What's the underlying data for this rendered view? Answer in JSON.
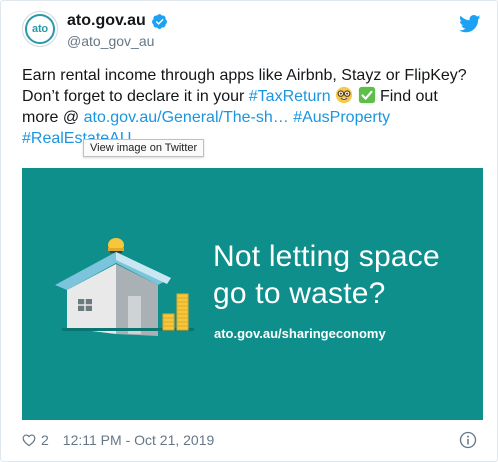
{
  "account": {
    "avatar_text": "ato",
    "display_name": "ato.gov.au",
    "handle": "@ato_gov_au"
  },
  "tweet": {
    "line1": "Earn rental income through apps like Airbnb, Stayz or FlipKey?",
    "line2_prefix": "Don’t forget to declare it in your ",
    "hashtag_taxreturn": "#TaxReturn",
    "line2_suffix": " Find out",
    "line3_prefix": "more @ ",
    "link": "ato.gov.au/General/The-sh…",
    "hashtag_ausproperty": "#AusProperty",
    "hashtag_realestate": "#RealEstateAU"
  },
  "tooltip": "View image on Twitter",
  "image": {
    "headline_line1": "Not letting space",
    "headline_line2": "go to waste?",
    "url": "ato.gov.au/sharingeconomy",
    "background": "#0e8f8c"
  },
  "footer": {
    "likes": "2",
    "timestamp": "12:11 PM - Oct 21, 2019"
  },
  "colors": {
    "link": "#1b95e0",
    "text": "#14171a",
    "muted": "#657786",
    "brand_teal": "#2a9aa8"
  }
}
